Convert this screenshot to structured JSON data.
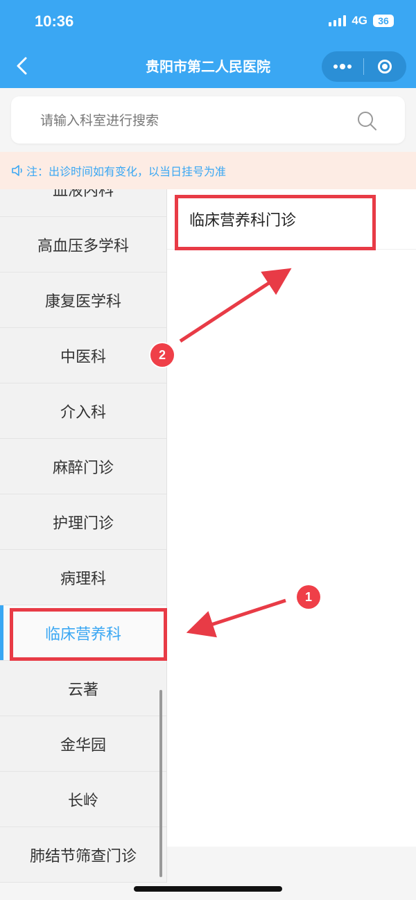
{
  "status_bar": {
    "time": "10:36",
    "network": "4G",
    "battery": "36"
  },
  "nav": {
    "title": "贵阳市第二人民医院"
  },
  "search": {
    "placeholder": "请输入科室进行搜索"
  },
  "notice": {
    "text": "注：出诊时间如有变化，以当日挂号为准"
  },
  "sidebar": {
    "items": [
      {
        "label": "血液内科"
      },
      {
        "label": "高血压多学科"
      },
      {
        "label": "康复医学科"
      },
      {
        "label": "中医科"
      },
      {
        "label": "介入科"
      },
      {
        "label": "麻醉门诊"
      },
      {
        "label": "护理门诊"
      },
      {
        "label": "病理科"
      },
      {
        "label": "临床营养科",
        "active": true
      },
      {
        "label": "云著"
      },
      {
        "label": "金华园"
      },
      {
        "label": "长岭"
      },
      {
        "label": "肺结节筛查门诊"
      }
    ]
  },
  "main": {
    "items": [
      {
        "label": "临床营养科门诊"
      }
    ]
  },
  "annotations": {
    "badge_1": "1",
    "badge_2": "2"
  },
  "colors": {
    "primary": "#3aa7f3",
    "highlight": "#e83b46",
    "notice_bg": "#fdece4"
  },
  "icons": [
    "back-chevron-icon",
    "more-dots-icon",
    "close-target-icon",
    "search-icon",
    "speaker-icon"
  ]
}
